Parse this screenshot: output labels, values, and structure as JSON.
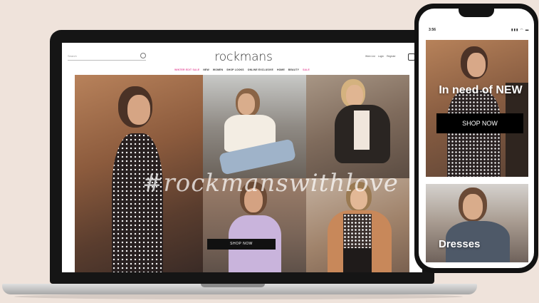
{
  "laptop_site": {
    "search": {
      "placeholder": "Search"
    },
    "logo": "rockmans",
    "header_links": [
      "Wish List",
      "Login",
      "Register"
    ],
    "nav": [
      {
        "label": "WINTER EDIT SALE",
        "highlight": true
      },
      {
        "label": "NEW",
        "highlight": false
      },
      {
        "label": "WOMEN",
        "highlight": false
      },
      {
        "label": "SHOP LOOKS",
        "highlight": false
      },
      {
        "label": "ONLINE EXCLUSIVE",
        "highlight": false
      },
      {
        "label": "HOME",
        "highlight": false
      },
      {
        "label": "BEAUTY",
        "highlight": false
      },
      {
        "label": "SALE",
        "highlight": true
      }
    ],
    "hashtag": "#rockmanswithlove",
    "shop_button": "SHOP NOW"
  },
  "phone_site": {
    "status_time": "3:56",
    "status_icons": "▮▮▮ ◠ ▬",
    "hero_title": "In need of NEW",
    "shop_button": "SHOP NOW",
    "second_title": "Dresses"
  },
  "colors": {
    "background": "#efe3db",
    "accent_pink": "#e4509b",
    "button": "#111111"
  }
}
